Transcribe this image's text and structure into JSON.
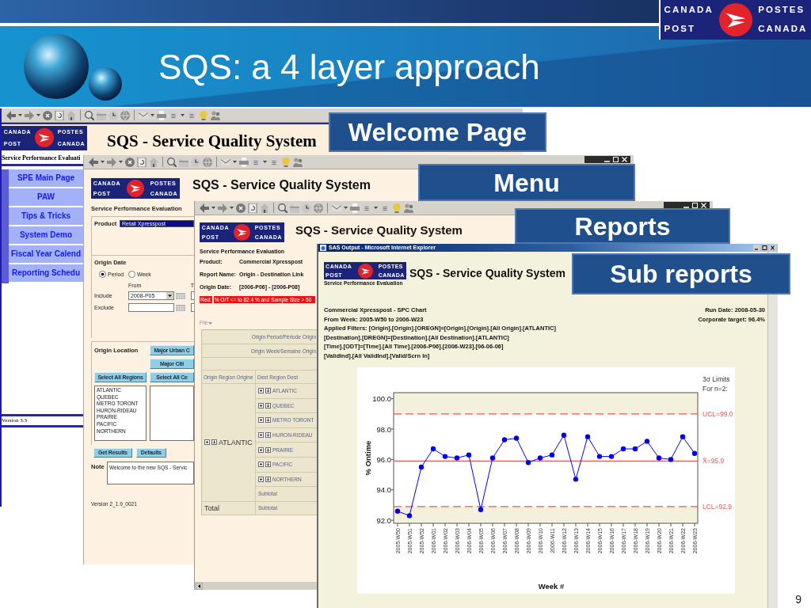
{
  "slide": {
    "title": "SQS: a 4 layer approach",
    "logo": [
      "CANADA",
      "POSTES",
      "POST",
      "CANADA"
    ],
    "page_number": "9"
  },
  "welcome_window": {
    "callout": "Welcome Page",
    "logo": [
      "CANADA",
      "POSTES",
      "POST",
      "CANADA"
    ],
    "title": "SQS - Service Quality System",
    "subtitle": "Service Performance Evaluati",
    "nav_items": [
      {
        "label": "SPE Main Page"
      },
      {
        "label": "PAW"
      },
      {
        "label": "Tips & Tricks"
      },
      {
        "label": "System Demo"
      },
      {
        "label": "Fiscal Year Calend"
      },
      {
        "label": "Reporting Schedu"
      }
    ],
    "version": "Version 3.3"
  },
  "menu_window": {
    "callout": "Menu",
    "logo": [
      "CANADA",
      "POSTES",
      "POST",
      "CANADA"
    ],
    "title": "SQS - Service Quality System",
    "subtitle": "Service Performance Evaluation",
    "product": {
      "label": "Product",
      "value": "Retail Xpresspost"
    },
    "origin_date": {
      "title": "Origin Date",
      "options": [
        {
          "label": "Period",
          "selected": true
        },
        {
          "label": "Week",
          "selected": false
        }
      ],
      "from_label": "From",
      "to_label": "T",
      "include": {
        "label": "Include",
        "value": "2008-P05"
      },
      "exclude": {
        "label": "Exclude"
      }
    },
    "origin_location": {
      "title": "Origin Location",
      "buttons": [
        "Major Urban C",
        "Major Citi",
        "Select All Regions",
        "Select All Ce"
      ],
      "regions": [
        "ATLANTIC",
        "QUEBEC",
        "METRO TORONT",
        "HURON-RIDEAU",
        "PRAIRIE",
        "PACIFIC",
        "NORTHERN"
      ]
    },
    "actions": [
      "Get Results",
      "Defaults"
    ],
    "note": {
      "label": "Note",
      "value": "Welcome to the new SQS - Servic"
    },
    "version": "Version 2_1.9_0021"
  },
  "reports_window": {
    "callout": "Reports",
    "logo": [
      "CANADA",
      "POSTES",
      "POST",
      "CANADA"
    ],
    "title": "SQS - Service Quality System",
    "subtitle": "Service Performance Evaluation",
    "fields": [
      {
        "label": "Product:",
        "value": "Commercial Xpresspost"
      },
      {
        "label": "Report Name:",
        "value": "Origin - Destination Link"
      },
      {
        "label": "Origin Date:",
        "value": "[2006-P06] - [2006-P08]"
      }
    ],
    "legend": {
      "label": "Red:",
      "text": "% O/T <= to 82.4 % and Sample Size > 50"
    },
    "file_menu": "File",
    "table": {
      "column_headers": [
        "Origin Period/Période Origin",
        "Origin Week/Semaine Origin"
      ],
      "row_headers": [
        "Origin Region Origine",
        "Dest Region Dest"
      ],
      "rows": [
        {
          "label": "ATLANTIC",
          "children": [
            {
              "label": "ATLANTIC"
            },
            {
              "label": "QUEBEC"
            },
            {
              "label": "METRO TORONT"
            },
            {
              "label": "HURON-RIDEAU"
            },
            {
              "label": "PRAIRIE"
            },
            {
              "label": "PACIFIC"
            },
            {
              "label": "NORTHERN"
            }
          ],
          "subtotal": "Subtotal"
        }
      ],
      "total": {
        "label": "Total",
        "value": "Subtotal"
      }
    }
  },
  "sub_report_window": {
    "callout": "Sub reports",
    "title_bar": "SAS Output - Microsoft Internet Explorer",
    "logo": [
      "CANADA",
      "POSTES",
      "POST",
      "CANADA"
    ],
    "title": "SQS - Service Quality System",
    "subtitle": "Service Performance Evaluation",
    "report_lines": [
      "Commercial Xpresspost - SPC Chart",
      "From Week: 2005-W50 to 2006-W23",
      "Applied Filters: [Origin].[Origin].[OREGN]=[Origin].[Origin].[All Origin].[ATLANTIC]",
      "[Destination].[DREGN]=[Destination].[All Destination].[ATLANTIC]",
      "[Time].[ODT]=[Time].[All Time].[2006-P06].[2006-W23].[06-06-06]",
      "[ValidInd].[All ValidInd].[Valid/Scrn In]"
    ],
    "run_info": [
      "Run Date: 2008-05-30",
      "Corporate target: 96.4%"
    ],
    "chart": {
      "limits_note": [
        "3σ Limits",
        "For n=2:"
      ],
      "chart_data": {
        "type": "line",
        "xlabel": "Week #",
        "ylabel": "% Ontime",
        "categories": [
          "2005-W50",
          "2005-W51",
          "2005-W52",
          "2006-W01",
          "2006-W02",
          "2006-W03",
          "2006-W04",
          "2006-W05",
          "2006-W06",
          "2006-W07",
          "2006-W08",
          "2006-W09",
          "2006-W10",
          "2006-W11",
          "2006-W12",
          "2006-W13",
          "2006-W14",
          "2006-W15",
          "2006-W16",
          "2006-W17",
          "2006-W18",
          "2006-W19",
          "2006-W20",
          "2006-W21",
          "2006-W22",
          "2006-W23"
        ],
        "series": [
          {
            "color": "#0000ee",
            "marker": "circle",
            "values": [
              92.6,
              92.3,
              95.5,
              96.7,
              96.2,
              96.1,
              96.3,
              92.7,
              96.1,
              97.3,
              97.4,
              95.8,
              96.1,
              96.3,
              97.6,
              94.7,
              97.5,
              96.2,
              96.2,
              96.7,
              96.7,
              97.2,
              96.1,
              96.0,
              97.5,
              96.4
            ]
          }
        ],
        "ylim": [
          91.8,
          100.4
        ],
        "yticks": [
          {
            "value": 92,
            "label": "92.0"
          },
          {
            "value": 94,
            "label": "94.0"
          },
          {
            "value": 96,
            "label": "96.0"
          },
          {
            "value": 98,
            "label": "98.0"
          },
          {
            "value": 100,
            "label": "100.0"
          }
        ],
        "ref_lines": [
          {
            "axis": "y",
            "value": 99.0,
            "label": "UCL=99.0",
            "color": "#e25a5a"
          },
          {
            "axis": "y",
            "value": 95.9,
            "label": "X̄=95.9",
            "color": "#e25a5a"
          },
          {
            "axis": "y",
            "value": 92.9,
            "label": "LCL=92.9",
            "color": "#e25a5a"
          }
        ],
        "bands": [
          {
            "axis": "y",
            "from": 99.0,
            "to": 100.4,
            "color": "#f3f1dc"
          },
          {
            "axis": "y",
            "from": 91.8,
            "to": 92.9,
            "color": "#f3f1dc"
          }
        ]
      }
    }
  }
}
